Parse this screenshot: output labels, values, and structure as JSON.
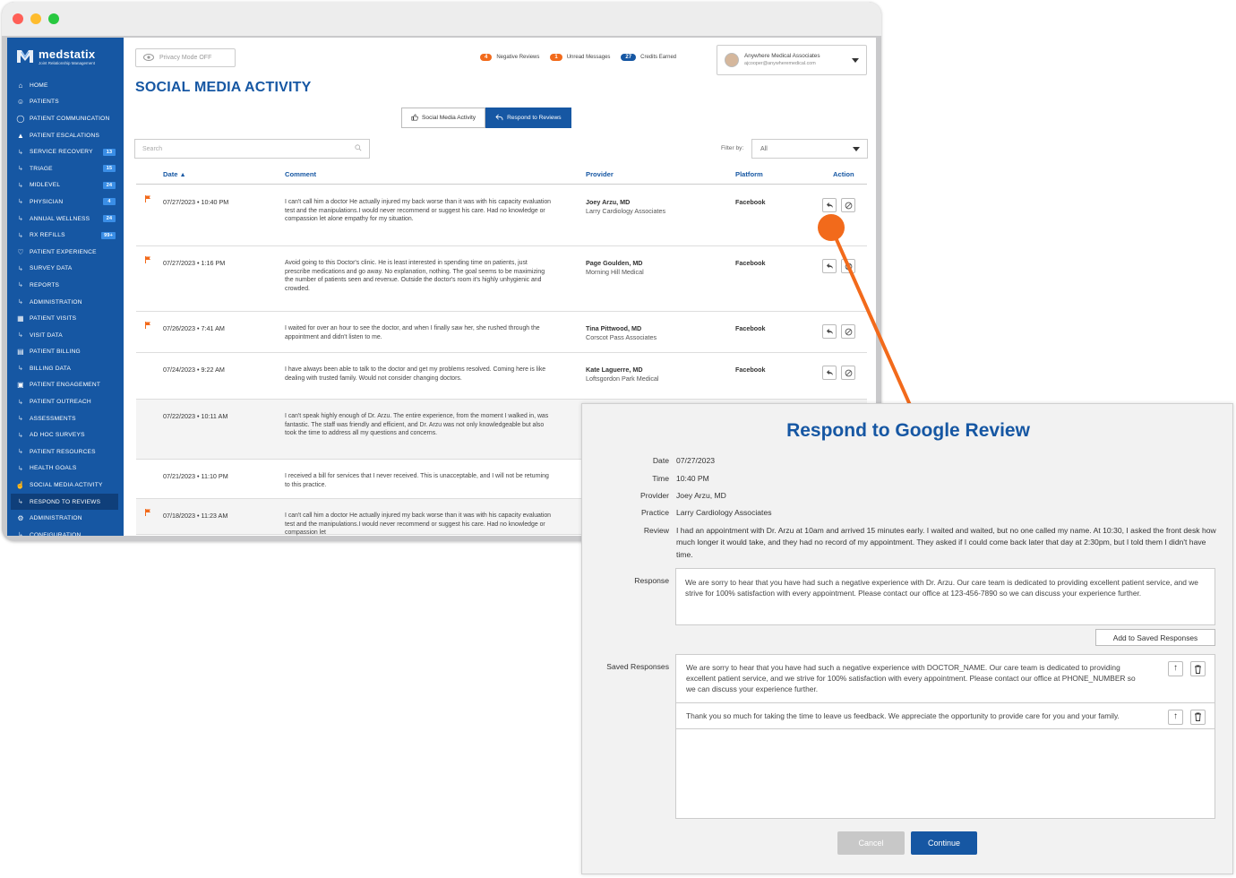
{
  "colors": {
    "brand": "#1657a3",
    "accent": "#f26a1b",
    "window_red": "#ff5f57",
    "window_yellow": "#febc2e",
    "window_green": "#28c840"
  },
  "logo": {
    "name": "medstatix",
    "tagline": "Joint Relationship Management"
  },
  "sidebar": {
    "items": [
      {
        "label": "HOME",
        "icon": "home-icon",
        "sub": false,
        "badge": null,
        "active": false
      },
      {
        "label": "PATIENTS",
        "icon": "users-icon",
        "sub": false,
        "badge": null,
        "active": false
      },
      {
        "label": "PATIENT COMMUNICATION",
        "icon": "chat-icon",
        "sub": false,
        "badge": null,
        "active": false
      },
      {
        "label": "PATIENT ESCALATIONS",
        "icon": "escalation-icon",
        "sub": false,
        "badge": null,
        "active": false
      },
      {
        "label": "SERVICE RECOVERY",
        "icon": "sub-arrow-icon",
        "sub": true,
        "badge": "13",
        "active": false
      },
      {
        "label": "TRIAGE",
        "icon": "sub-arrow-icon",
        "sub": true,
        "badge": "15",
        "active": false
      },
      {
        "label": "MIDLEVEL",
        "icon": "sub-arrow-icon",
        "sub": true,
        "badge": "24",
        "active": false
      },
      {
        "label": "PHYSICIAN",
        "icon": "sub-arrow-icon",
        "sub": true,
        "badge": "4",
        "active": false
      },
      {
        "label": "ANNUAL WELLNESS",
        "icon": "sub-arrow-icon",
        "sub": true,
        "badge": "24",
        "active": false
      },
      {
        "label": "RX REFILLS",
        "icon": "sub-arrow-icon",
        "sub": true,
        "badge": "99+",
        "active": false
      },
      {
        "label": "PATIENT EXPERIENCE",
        "icon": "heart-icon",
        "sub": false,
        "badge": null,
        "active": false
      },
      {
        "label": "SURVEY DATA",
        "icon": "sub-arrow-icon",
        "sub": true,
        "badge": null,
        "active": false
      },
      {
        "label": "REPORTS",
        "icon": "sub-arrow-icon",
        "sub": true,
        "badge": null,
        "active": false
      },
      {
        "label": "ADMINISTRATION",
        "icon": "sub-arrow-icon",
        "sub": true,
        "badge": null,
        "active": false
      },
      {
        "label": "PATIENT VISITS",
        "icon": "calendar-icon",
        "sub": false,
        "badge": null,
        "active": false
      },
      {
        "label": "VISIT DATA",
        "icon": "sub-arrow-icon",
        "sub": true,
        "badge": null,
        "active": false
      },
      {
        "label": "PATIENT BILLING",
        "icon": "billing-icon",
        "sub": false,
        "badge": null,
        "active": false
      },
      {
        "label": "BILLING DATA",
        "icon": "sub-arrow-icon",
        "sub": true,
        "badge": null,
        "active": false
      },
      {
        "label": "PATIENT ENGAGEMENT",
        "icon": "engagement-icon",
        "sub": false,
        "badge": null,
        "active": false
      },
      {
        "label": "PATIENT OUTREACH",
        "icon": "sub-arrow-icon",
        "sub": true,
        "badge": null,
        "active": false
      },
      {
        "label": "ASSESSMENTS",
        "icon": "sub-arrow-icon",
        "sub": true,
        "badge": null,
        "active": false
      },
      {
        "label": "AD HOC SURVEYS",
        "icon": "sub-arrow-icon",
        "sub": true,
        "badge": null,
        "active": false
      },
      {
        "label": "PATIENT RESOURCES",
        "icon": "sub-arrow-icon",
        "sub": true,
        "badge": null,
        "active": false
      },
      {
        "label": "HEALTH GOALS",
        "icon": "sub-arrow-icon",
        "sub": true,
        "badge": null,
        "active": false
      },
      {
        "label": "SOCIAL MEDIA ACTIVITY",
        "icon": "thumbs-up-icon",
        "sub": false,
        "badge": null,
        "active": false
      },
      {
        "label": "RESPOND TO REVIEWS",
        "icon": "sub-arrow-icon",
        "sub": true,
        "badge": null,
        "active": true
      },
      {
        "label": "ADMINISTRATION",
        "icon": "gear-icon",
        "sub": false,
        "badge": null,
        "active": false
      },
      {
        "label": "CONFIGURATION",
        "icon": "sub-arrow-icon",
        "sub": true,
        "badge": null,
        "active": false
      }
    ]
  },
  "header": {
    "privacy_label": "Privacy Mode OFF",
    "stats": [
      {
        "count": "4",
        "label": "Negative Reviews",
        "color": "#f26a1b"
      },
      {
        "count": "1",
        "label": "Unread Messages",
        "color": "#f26a1b"
      },
      {
        "count": "27",
        "label": "Credits Earned",
        "color": "#1657a3"
      }
    ],
    "account_name": "Anywhere Medical Associates",
    "account_email": "ajcooper@anywheremedical.com"
  },
  "page_title": "SOCIAL MEDIA ACTIVITY",
  "tabs": [
    {
      "label": "Social Media Activity",
      "active": false
    },
    {
      "label": "Respond to Reviews",
      "active": true
    }
  ],
  "search": {
    "placeholder": "Search"
  },
  "filter": {
    "label": "Filter by:",
    "value": "All"
  },
  "table": {
    "columns": {
      "date": "Date",
      "comment": "Comment",
      "provider": "Provider",
      "platform": "Platform",
      "action": "Action"
    },
    "rows": [
      {
        "flag": true,
        "date": "07/27/2023 • 10:40 PM",
        "comment": "I can't call him a doctor He actually injured my back worse than it was with his capacity evaluation test and the manipulations.I would never recommend or suggest his care. Had no knowledge or compassion let alone empathy for my situation.",
        "provider": "Joey Arzu, MD",
        "practice": "Larry Cardiology Associates",
        "platform": "Facebook"
      },
      {
        "flag": true,
        "date": "07/27/2023 • 1:16 PM",
        "comment": "Avoid going to this Doctor's clinic. He is least interested in spending time on patients, just prescribe medications and go away. No explanation, nothing. The goal seems to be maximizing the number of patients seen and revenue. Outside the doctor's room it's highly unhygienic and crowded.",
        "provider": "Page Goulden, MD",
        "practice": "Morning Hill Medical",
        "platform": "Facebook"
      },
      {
        "flag": true,
        "date": "07/26/2023 • 7:41 AM",
        "comment": "I waited for over an hour to see the doctor, and when I finally saw her, she rushed through the appointment and didn't listen to me.",
        "provider": "Tina Pittwood, MD",
        "practice": "Corscot Pass Associates",
        "platform": "Facebook"
      },
      {
        "flag": false,
        "date": "07/24/2023 • 9:22 AM",
        "comment": "I have always been able to talk to the doctor and get my problems resolved. Coming here is like dealing with trusted family. Would not consider changing doctors.",
        "provider": "Kate Laguerre, MD",
        "practice": "Loftsgordon Park Medical",
        "platform": "Facebook"
      },
      {
        "flag": false,
        "date": "07/22/2023 • 10:11 AM",
        "comment": "I can't speak highly enough of Dr. Arzu. The entire experience, from the moment I walked in, was fantastic. The staff was friendly and efficient, and Dr. Arzu was not only knowledgeable but also took the time to address all my questions and concerns.",
        "provider": "",
        "practice": "",
        "platform": ""
      },
      {
        "flag": false,
        "date": "07/21/2023 • 11:10 PM",
        "comment": "I received a bill for services that I never received. This is unacceptable, and I will not be returning to this practice.",
        "provider": "",
        "practice": "",
        "platform": ""
      },
      {
        "flag": true,
        "date": "07/18/2023 • 11:23 AM",
        "comment": "I can't call him a doctor He actually injured my back worse than it was with his capacity evaluation test and the manipulations.I would never recommend or suggest his care. Had no knowledge or compassion let",
        "provider": "",
        "practice": "",
        "platform": ""
      }
    ]
  },
  "modal": {
    "title": "Respond to Google Review",
    "labels": {
      "date": "Date",
      "time": "Time",
      "provider": "Provider",
      "practice": "Practice",
      "review": "Review",
      "response": "Response",
      "saved": "Saved Responses"
    },
    "date": "07/27/2023",
    "time": "10:40 PM",
    "provider": "Joey Arzu, MD",
    "practice": "Larry Cardiology Associates",
    "review": "I had an appointment with Dr. Arzu at 10am and arrived 15 minutes early. I waited and waited, but no one called my name. At 10:30, I asked the front desk how much longer it would take, and they had no record of my appointment. They asked if I could come back later that day at 2:30pm, but I told them I didn't have time.",
    "response": "We are sorry to hear that you have had such a negative experience with Dr. Arzu. Our care team is dedicated to providing excellent patient service, and we strive for 100% satisfaction with every appointment. Please contact our office at 123-456-7890 so we can discuss your experience further.",
    "add_saved_label": "Add to Saved Responses",
    "saved_responses": [
      "We are sorry to hear that you have had such a negative experience with DOCTOR_NAME. Our care team is dedicated to providing excellent patient service, and we strive for 100% satisfaction with every appointment. Please contact our office at PHONE_NUMBER so we can discuss your experience further.",
      "Thank you so much for taking the time to leave us feedback. We appreciate the opportunity to provide care for you and your family."
    ],
    "cancel_label": "Cancel",
    "continue_label": "Continue"
  }
}
